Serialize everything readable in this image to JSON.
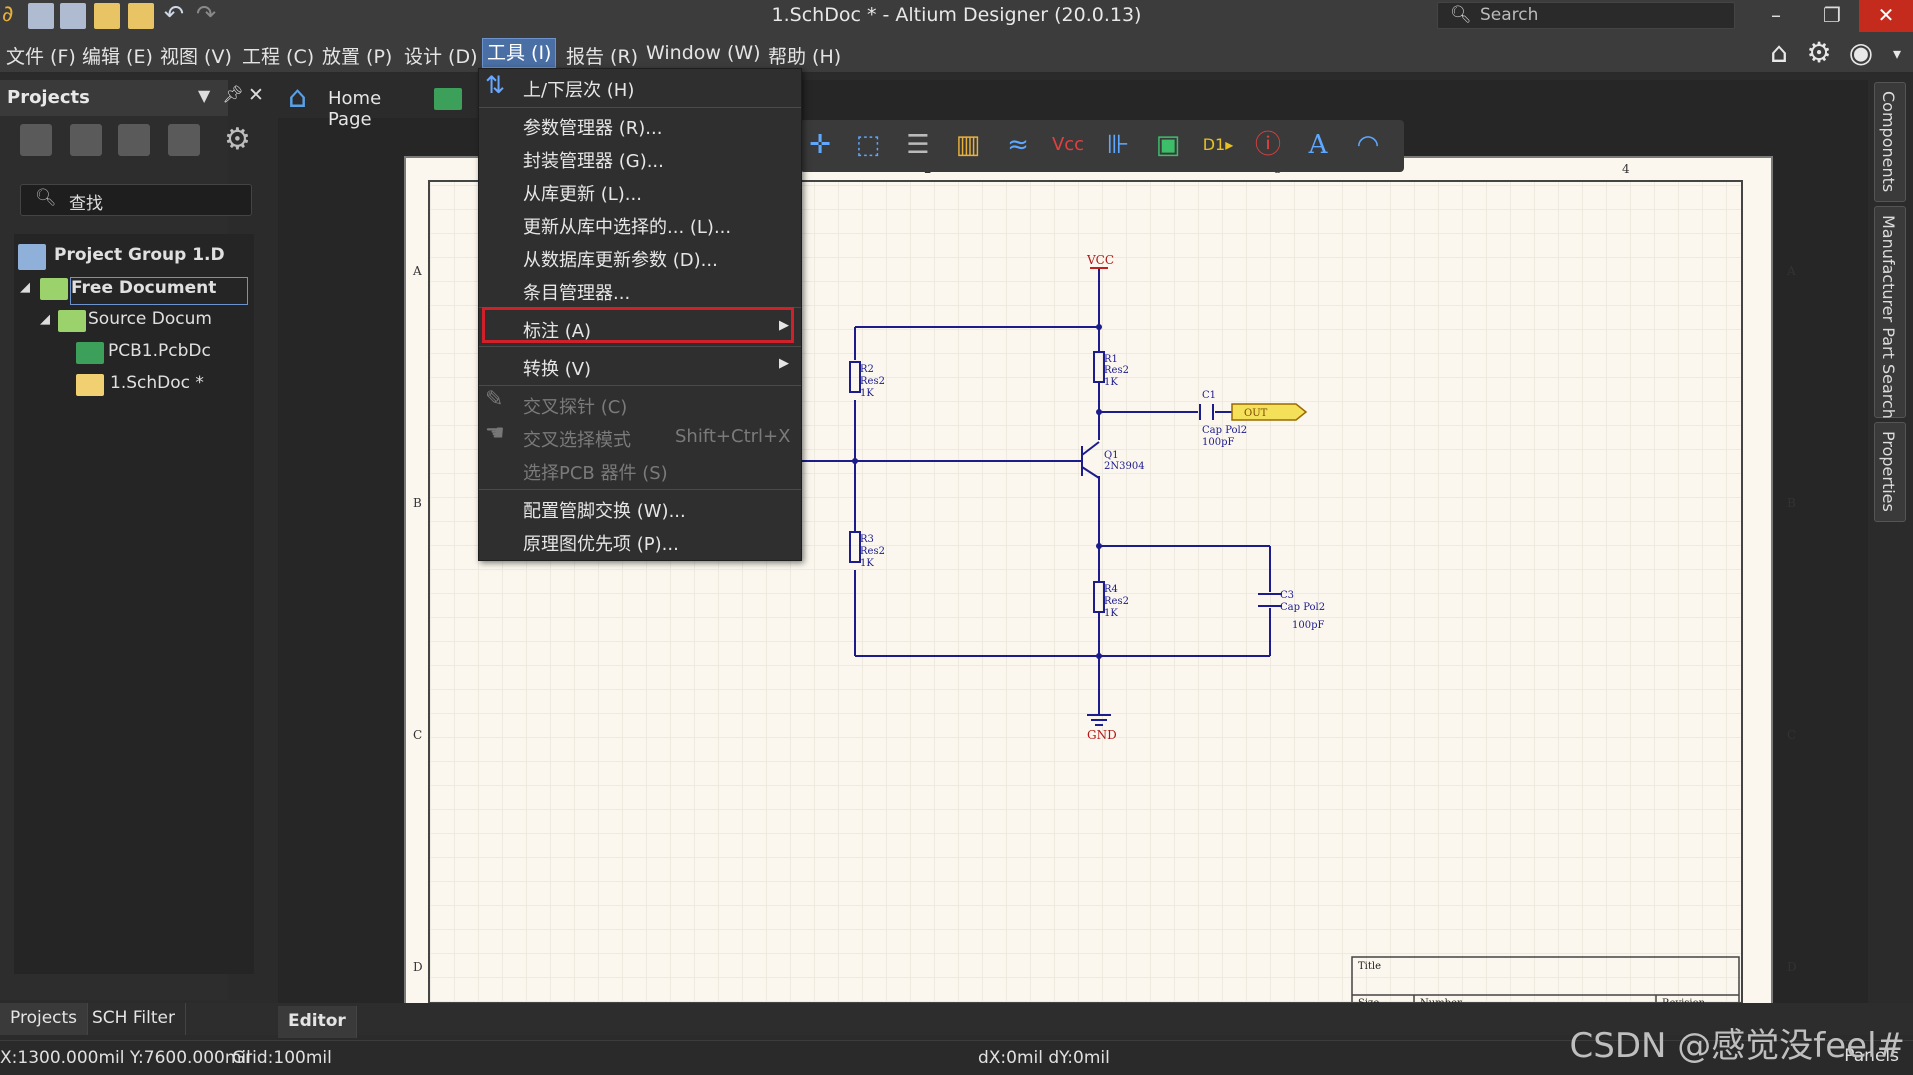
{
  "window": {
    "title": "1.SchDoc * - Altium Designer (20.0.13)",
    "search_placeholder": "Search"
  },
  "menubar": {
    "items": [
      "文件 (F)",
      "编辑 (E)",
      "视图 (V)",
      "工程 (C)",
      "放置 (P)",
      "设计 (D)",
      "工具 (I)",
      "报告 (R)",
      "Window (W)",
      "帮助 (H)"
    ],
    "active": "工具 (I)"
  },
  "projects_panel": {
    "title": "Projects",
    "search_placeholder": "查找",
    "tree": {
      "group": "Project Group 1.D",
      "free_docs": "Free Document",
      "source_docs": "Source Docum",
      "pcb": "PCB1.PcbDc",
      "sch": "1.SchDoc *"
    }
  },
  "doc_tabs": {
    "home": "Home Page"
  },
  "context_menu": {
    "items": [
      {
        "label": "上/下层次 (H)",
        "disabled": false,
        "submenu": false
      },
      {
        "label": "参数管理器 (R)...",
        "disabled": false,
        "submenu": false
      },
      {
        "label": "封装管理器 (G)...",
        "disabled": false,
        "submenu": false
      },
      {
        "label": "从库更新 (L)...",
        "disabled": false,
        "submenu": false
      },
      {
        "label": "更新从库中选择的... (L)...",
        "disabled": false,
        "submenu": false
      },
      {
        "label": "从数据库更新参数 (D)...",
        "disabled": false,
        "submenu": false
      },
      {
        "label": "条目管理器...",
        "disabled": false,
        "submenu": false
      },
      {
        "label": "标注 (A)",
        "disabled": false,
        "submenu": true,
        "highlighted": true
      },
      {
        "label": "转换 (V)",
        "disabled": false,
        "submenu": true
      },
      {
        "label": "交叉探针 (C)",
        "disabled": true,
        "submenu": false
      },
      {
        "label": "交叉选择模式",
        "shortcut": "Shift+Ctrl+X",
        "disabled": true,
        "submenu": false
      },
      {
        "label": "选择PCB 器件 (S)",
        "disabled": true,
        "submenu": false
      },
      {
        "label": "配置管脚交换 (W)...",
        "disabled": false,
        "submenu": false
      },
      {
        "label": "原理图优先项 (P)...",
        "disabled": false,
        "submenu": false
      }
    ]
  },
  "schematic": {
    "zones_rows": [
      "A",
      "B",
      "C",
      "D"
    ],
    "zones_cols": [
      "2",
      "3",
      "4"
    ],
    "parts": {
      "vcc": "VCC",
      "gnd": "GND",
      "r1": {
        "ref": "R1",
        "type": "Res2",
        "value": "1K"
      },
      "r2": {
        "ref": "R2",
        "type": "Res2",
        "value": "1K"
      },
      "r3": {
        "ref": "R3",
        "type": "Res2",
        "value": "1K"
      },
      "r4": {
        "ref": "R4",
        "type": "Res2",
        "value": "1K"
      },
      "c1": {
        "ref": "C1",
        "type": "Cap Pol2",
        "value": "100pF"
      },
      "c3": {
        "ref": "C3",
        "type": "Cap Pol2",
        "value": "100pF"
      },
      "q1": {
        "ref": "Q1",
        "type": "2N3904"
      },
      "port": "OUT"
    },
    "title_block": {
      "title": "Title",
      "size": "Size",
      "number": "Number",
      "revision": "Revision"
    }
  },
  "right_tabs": [
    "Components",
    "Manufacturer Part Search",
    "Properties"
  ],
  "bottom_tabs": [
    "Projects",
    "SCH Filter"
  ],
  "editor_tab": "Editor",
  "status": {
    "coords": "X:1300.000mil Y:7600.000mil",
    "grid": "Grid:100mil",
    "delta": "dX:0mil dY:0mil",
    "panels": "Panels"
  },
  "watermark": "CSDN @感觉没feel#",
  "colors": {
    "accent": "#4a6fa5",
    "wire": "#1c1c8c",
    "highlight_box": "#d0202a",
    "port_fill": "#f5e05a"
  }
}
